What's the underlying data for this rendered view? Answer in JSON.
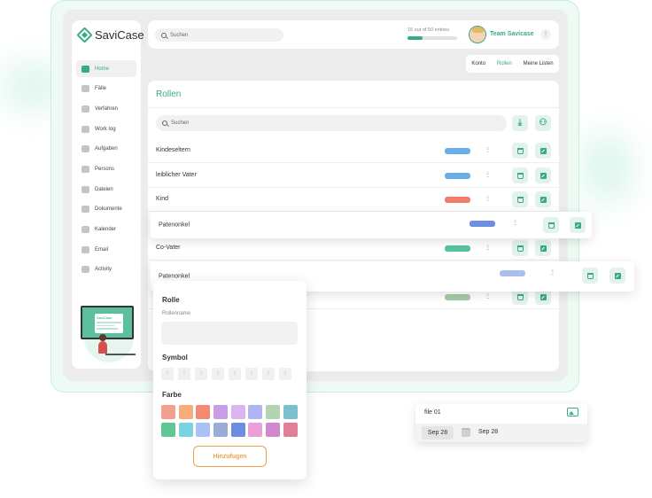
{
  "app": {
    "name": "SaviCase",
    "accent_color": "#3aa88a"
  },
  "sidebar": {
    "items": [
      {
        "label": "Home",
        "icon": "grid-icon",
        "active": true
      },
      {
        "label": "Fälle",
        "icon": "nodes-icon"
      },
      {
        "label": "Verfahren",
        "icon": "cycle-icon"
      },
      {
        "label": "Work log",
        "icon": "list-icon"
      },
      {
        "label": "Aufgaben",
        "icon": "tasks-icon"
      },
      {
        "label": "Persons",
        "icon": "people-icon"
      },
      {
        "label": "Dateien",
        "icon": "folder-icon"
      },
      {
        "label": "Dokumente",
        "icon": "document-icon"
      },
      {
        "label": "Kalender",
        "icon": "calendar-icon"
      },
      {
        "label": "Email",
        "icon": "send-icon"
      },
      {
        "label": "Activity",
        "icon": "activity-icon"
      }
    ],
    "illustration_brand": "SaviCase"
  },
  "header": {
    "search_placeholder": "Suchen",
    "entries_text": "15 out of 50 entries",
    "entries_progress": 0.3,
    "team_name": "Team Savicase",
    "menu_glyph": "⋮"
  },
  "tabs": [
    {
      "label": "Konto"
    },
    {
      "label": "Rollen",
      "active": true
    },
    {
      "label": "Meine Listen"
    }
  ],
  "main": {
    "title": "Rollen",
    "search_placeholder": "Suchen",
    "rows": [
      {
        "name": "Kindeseltern",
        "color": "#6aaee8"
      },
      {
        "name": "leiblicher Vater",
        "color": "#6aaee8"
      },
      {
        "name": "Kind",
        "color": "#f07e6a"
      },
      {
        "name": "Co-Vater",
        "color": "#55c49a"
      }
    ],
    "hidden_row_color": "#a4cba7",
    "symbol_glyph": "⫶⫶",
    "download_glyph": "⤓",
    "people_glyph": "⚇"
  },
  "floating_rows": [
    {
      "name": "Patenonkel",
      "color": "#6d8ee0"
    },
    {
      "name": "Patenonkel",
      "color": "#a9c0ef"
    }
  ],
  "form": {
    "role_title": "Rolle",
    "role_name_label": "Rollenname",
    "symbol_title": "Symbol",
    "symbol_glyph": "⫶⫶",
    "color_title": "Farbe",
    "colors": [
      "#f3a090",
      "#f7ad7a",
      "#f48a72",
      "#c99be8",
      "#dcb5f0",
      "#b0b4f7",
      "#b2d4b2",
      "#7bbfcc",
      "#5dc796",
      "#7ad3e0",
      "#a9c1f4",
      "#9aacd7",
      "#6d8ee0",
      "#ee9ed6",
      "#d089cc",
      "#e27f98"
    ],
    "add_button": "Hinzufugen"
  },
  "file_card": {
    "name": "file 01",
    "date_selected": "Sep 28",
    "date": "Sep 28"
  }
}
